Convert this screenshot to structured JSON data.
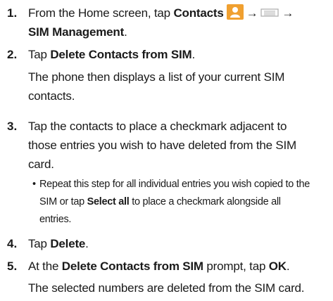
{
  "steps": [
    {
      "number": "1.",
      "line1_prefix": "From the Home screen, tap ",
      "line1_bold": "Contacts",
      "arrow1": "→",
      "arrow2": "→",
      "line2_bold": "SIM Management",
      "line2_suffix": "."
    },
    {
      "number": "2.",
      "line1_prefix": "Tap ",
      "line1_bold": "Delete Contacts from SIM",
      "line1_suffix": ".",
      "line2": "The phone then displays a list of your current SIM",
      "line3": "contacts."
    },
    {
      "number": "3.",
      "line1": "Tap the contacts to place a checkmark adjacent to",
      "line2": "those entries you wish to have deleted from the SIM",
      "line3": "card.",
      "bullet": "•",
      "sub_line1": "Repeat this step for all individual entries you wish copied to the",
      "sub_line2_prefix": "SIM or tap ",
      "sub_line2_bold": "Select all",
      "sub_line2_suffix": " to place a checkmark alongside all",
      "sub_line3": "entries."
    },
    {
      "number": "4.",
      "line1_prefix": "Tap ",
      "line1_bold": "Delete",
      "line1_suffix": "."
    },
    {
      "number": "5.",
      "line1_prefix": "At the ",
      "line1_bold": "Delete Contacts from SIM",
      "line1_mid": " prompt, tap ",
      "line1_bold2": "OK",
      "line1_suffix": ".",
      "line2": "The selected numbers are deleted from the SIM card."
    }
  ],
  "icons": {
    "contacts": "contacts-app-icon",
    "menu": "menu-key-icon",
    "accent": "#f0a030"
  }
}
